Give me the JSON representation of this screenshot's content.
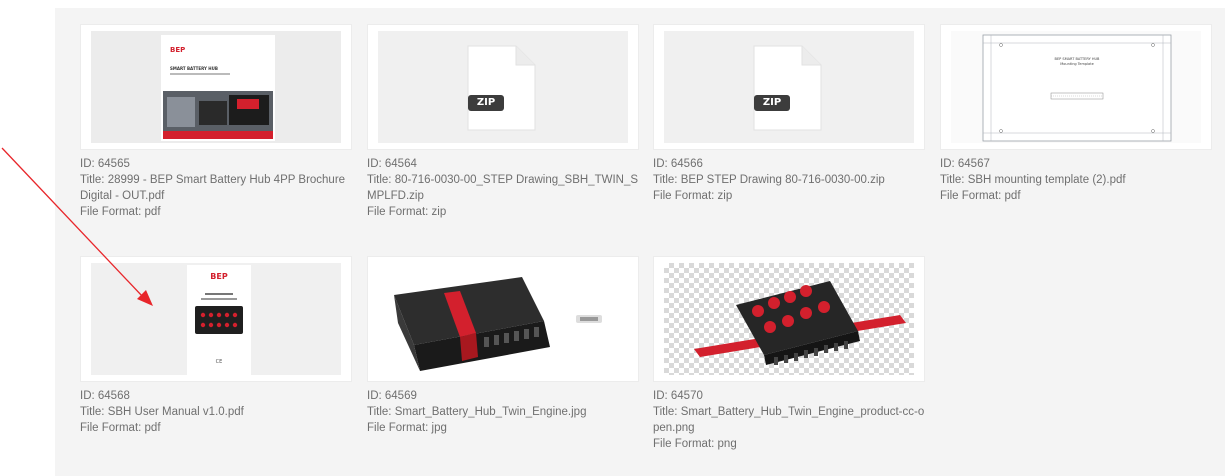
{
  "colors": {
    "panel_bg": "#f4f4f4",
    "text": "#6f6f6f",
    "bep_red": "#d3202d",
    "arrow": "#e8262b",
    "dark_product": "#2a2a2a"
  },
  "items": [
    {
      "id_text": "ID: 64565",
      "title_text": "Title: 28999 - BEP Smart Battery Hub 4PP Brochure Digital - OUT.pdf",
      "format_text": "File Format: pdf",
      "thumb": "brochure-cover",
      "thumb_text": {
        "brand": "BEP",
        "heading": "SMART BATTERY HUB"
      }
    },
    {
      "id_text": "ID: 64564",
      "title_text": "Title: 80-716-0030-00_STEP Drawing_SBH_TWIN_SMPLFD.zip",
      "format_text": "File Format: zip",
      "thumb": "zip-file-icon",
      "badge": "ZIP"
    },
    {
      "id_text": "ID: 64566",
      "title_text": "Title: BEP STEP Drawing 80-716-0030-00.zip",
      "format_text": "File Format: zip",
      "thumb": "zip-file-icon",
      "badge": "ZIP"
    },
    {
      "id_text": "ID: 64567",
      "title_text": "Title: SBH mounting template (2).pdf",
      "format_text": "File Format: pdf",
      "thumb": "mounting-template-drawing",
      "thumb_text": {
        "heading": "BEP SMART BATTERY HUB",
        "sub": "Mounting Template"
      }
    },
    {
      "id_text": "ID: 64568",
      "title_text": "Title: SBH User Manual v1.0.pdf",
      "format_text": "File Format: pdf",
      "thumb": "user-manual-cover",
      "thumb_text": {
        "brand": "BEP",
        "footer": "CE"
      }
    },
    {
      "id_text": "ID: 64569",
      "title_text": "Title: Smart_Battery_Hub_Twin_Engine.jpg",
      "format_text": "File Format: jpg",
      "thumb": "battery-hub-product-photo"
    },
    {
      "id_text": "ID: 64570",
      "title_text": "Title: Smart_Battery_Hub_Twin_Engine_product-cc-open.png",
      "format_text": "File Format: png",
      "thumb": "battery-hub-open-transparent"
    }
  ],
  "annotation": {
    "type": "arrow",
    "color": "#e8262b",
    "points_to": "SBH User Manual v1.0.pdf"
  }
}
